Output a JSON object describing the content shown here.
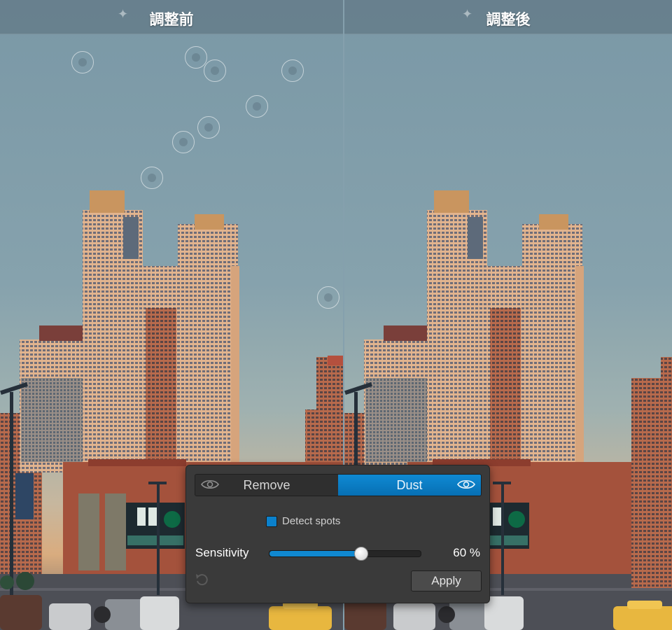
{
  "before_panel": {
    "title": "調整前",
    "icon": "sparkle-icon"
  },
  "after_panel": {
    "title": "調整後",
    "icon": "sparkle-icon"
  },
  "dust_panel": {
    "mode_remove_label": "Remove",
    "mode_dust_label": "Dust",
    "active_mode": "Dust",
    "detect_spots_label": "Detect spots",
    "detect_spots_checked": true,
    "sensitivity_label": "Sensitivity",
    "sensitivity_value": 60,
    "sensitivity_text": "60 %",
    "apply_label": "Apply",
    "accent_color": "#0b81cc"
  }
}
